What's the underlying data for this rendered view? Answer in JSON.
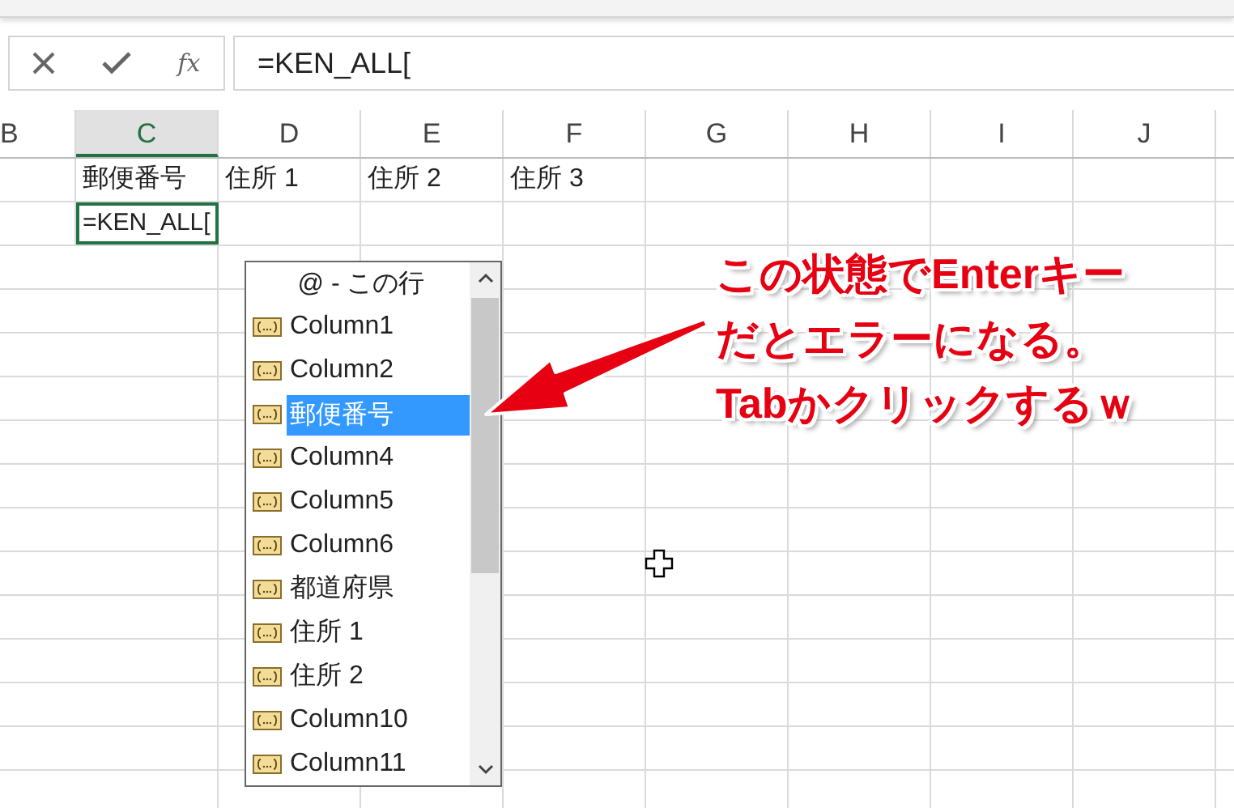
{
  "formula_bar": {
    "function_label": "fx",
    "value": "=KEN_ALL["
  },
  "columns": [
    {
      "label": "B",
      "selected": false
    },
    {
      "label": "C",
      "selected": true
    },
    {
      "label": "D",
      "selected": false
    },
    {
      "label": "E",
      "selected": false
    },
    {
      "label": "F",
      "selected": false
    },
    {
      "label": "G",
      "selected": false
    },
    {
      "label": "H",
      "selected": false
    },
    {
      "label": "I",
      "selected": false
    },
    {
      "label": "J",
      "selected": false
    }
  ],
  "rows": [
    [
      {
        "selected": false
      },
      {
        "text": "郵便番号",
        "selected": false
      },
      {
        "text": "住所 1",
        "selected": false
      },
      {
        "text": "住所 2",
        "selected": false
      },
      {
        "text": "住所 3",
        "selected": false
      }
    ],
    [
      {
        "selected": false
      },
      {
        "text": "=KEN_ALL[",
        "selected": true
      }
    ]
  ],
  "autocomplete": {
    "items": [
      {
        "kind": "special",
        "label": "@ - この行",
        "selected": false
      },
      {
        "kind": "field",
        "label": "Column1",
        "selected": false
      },
      {
        "kind": "field",
        "label": "Column2",
        "selected": false
      },
      {
        "kind": "field",
        "label": "郵便番号",
        "selected": true
      },
      {
        "kind": "field",
        "label": "Column4",
        "selected": false
      },
      {
        "kind": "field",
        "label": "Column5",
        "selected": false
      },
      {
        "kind": "field",
        "label": "Column6",
        "selected": false
      },
      {
        "kind": "field",
        "label": "都道府県",
        "selected": false
      },
      {
        "kind": "field",
        "label": "住所 1",
        "selected": false
      },
      {
        "kind": "field",
        "label": "住所 2",
        "selected": false
      },
      {
        "kind": "field",
        "label": "Column10",
        "selected": false
      },
      {
        "kind": "field",
        "label": "Column11",
        "selected": false
      }
    ]
  },
  "annotation": {
    "lines": [
      "この状態でEnterキー",
      "だとエラーになる。",
      "Tabかクリックするｗ"
    ]
  }
}
